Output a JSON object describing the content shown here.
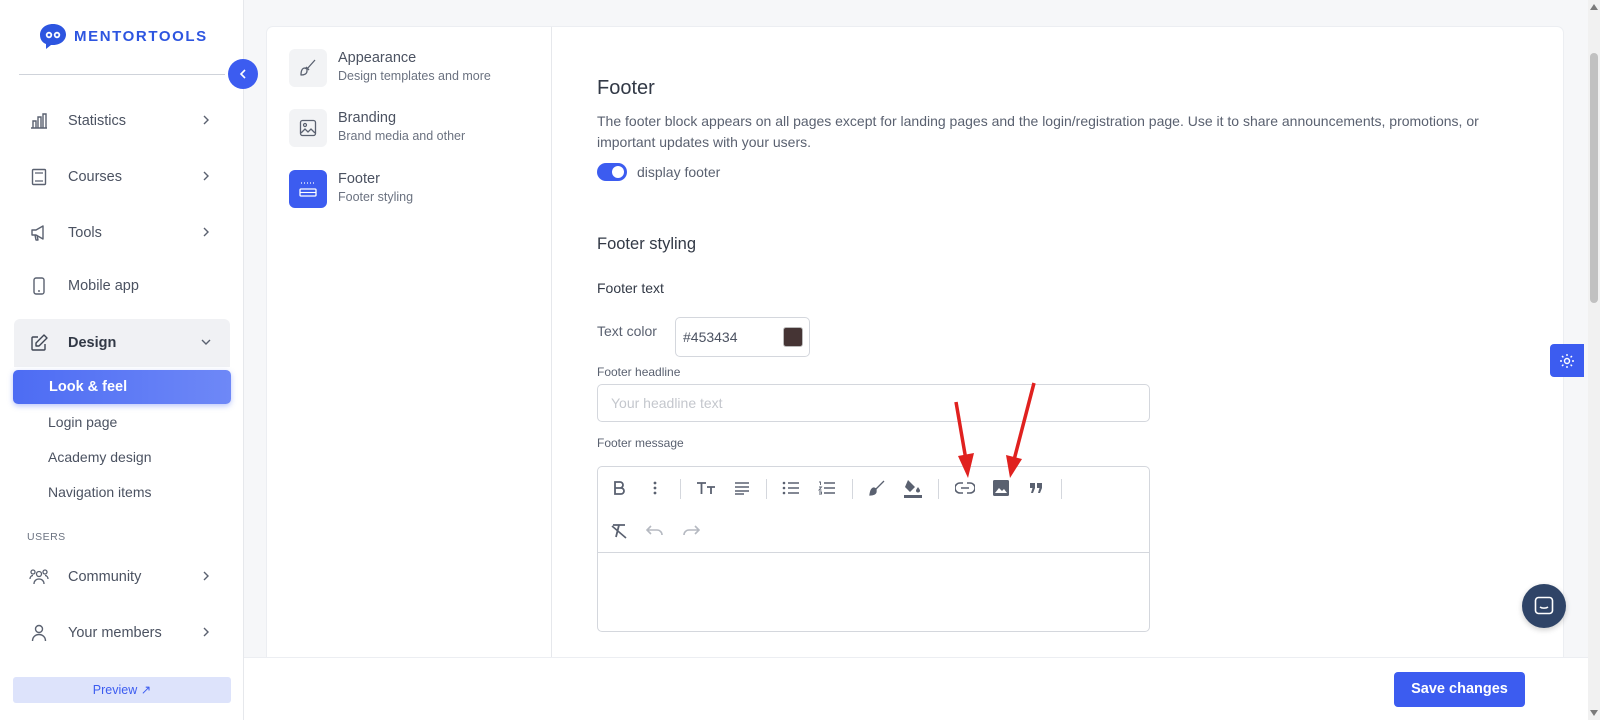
{
  "brand": {
    "name": "MENTORTOOLS",
    "accent": "#3c5cf0"
  },
  "sidebar": {
    "items": [
      {
        "label": "Statistics",
        "icon": "bar-chart-icon"
      },
      {
        "label": "Courses",
        "icon": "book-icon"
      },
      {
        "label": "Tools",
        "icon": "megaphone-icon"
      },
      {
        "label": "Mobile app",
        "icon": "phone-icon"
      },
      {
        "label": "Design",
        "icon": "edit-icon"
      }
    ],
    "design_sub": [
      "Look & feel",
      "Login page",
      "Academy design",
      "Navigation items"
    ],
    "section_users": "USERS",
    "user_items": [
      {
        "label": "Community",
        "icon": "people-icon"
      },
      {
        "label": "Your members",
        "icon": "user-icon"
      }
    ],
    "preview": "Preview ↗"
  },
  "settings_nav": [
    {
      "title": "Appearance",
      "subtitle": "Design templates and more",
      "icon": "brush-icon"
    },
    {
      "title": "Branding",
      "subtitle": "Brand media and other",
      "icon": "image-icon"
    },
    {
      "title": "Footer",
      "subtitle": "Footer styling",
      "icon": "footer-layout-icon"
    }
  ],
  "main": {
    "title": "Footer",
    "description": "The footer block appears on all pages except for landing pages and the login/registration page. Use it to share announcements, promotions, or important updates with your users.",
    "toggle_label": "display footer",
    "toggle_on": true,
    "styling_title": "Footer styling",
    "footer_text_title": "Footer text",
    "text_color_label": "Text color",
    "text_color_value": "#453434",
    "headline_label": "Footer headline",
    "headline_placeholder": "Your headline text",
    "message_label": "Footer message"
  },
  "toolbar_icons": [
    "bold-icon",
    "more-vertical-icon",
    "text-size-icon",
    "align-icon",
    "bullet-list-icon",
    "numbered-list-icon",
    "brush-color-icon",
    "fill-color-icon",
    "link-icon",
    "image-icon",
    "quote-icon",
    "clear-format-icon",
    "undo-icon",
    "redo-icon"
  ],
  "footer": {
    "save": "Save changes"
  }
}
